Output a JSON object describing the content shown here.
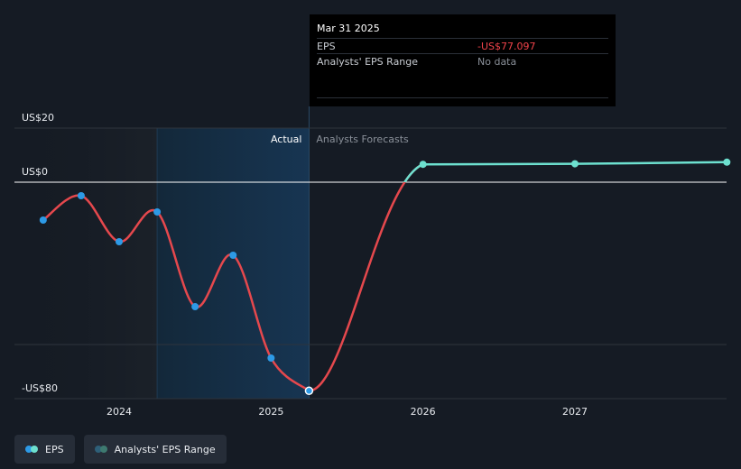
{
  "chart_data": {
    "type": "line",
    "y_ticks": [
      {
        "label": "US$20",
        "value": 20
      },
      {
        "label": "US$0",
        "value": 0
      },
      {
        "label": "-US$80",
        "value": -80
      }
    ],
    "ylim": [
      -80,
      20
    ],
    "x_ticks": [
      {
        "label": "2024",
        "value": 2024.0
      },
      {
        "label": "2025",
        "value": 2025.0
      },
      {
        "label": "2026",
        "value": 2026.0
      },
      {
        "label": "2027",
        "value": 2027.0
      }
    ],
    "xlim": [
      2023.3,
      2028.0
    ],
    "actual_start": 2024.25,
    "forecast_start": 2025.25,
    "region_labels": {
      "actual": "Actual",
      "forecast": "Analysts Forecasts"
    },
    "actual_series": {
      "name": "EPS",
      "x": [
        2023.5,
        2023.75,
        2024.0,
        2024.25,
        2024.5,
        2024.75,
        2025.0,
        2025.25
      ],
      "y": [
        -14,
        -5,
        -22,
        -11,
        -46,
        -27,
        -65,
        -77.1
      ]
    },
    "forecast_series": {
      "name": "EPS",
      "x": [
        2026.0,
        2027.0,
        2028.0
      ],
      "y": [
        6.6,
        6.8,
        7.4
      ]
    },
    "colors": {
      "actual": "#e5484d",
      "forecast": "#6de0cf",
      "point": "#2d9ae6",
      "background": "#151b24"
    },
    "gridlines": true,
    "legend": [
      {
        "label": "EPS",
        "colors": [
          "#2d9ae6",
          "#6de0cf"
        ]
      },
      {
        "label": "Analysts' EPS Range",
        "colors": [
          "#2e5f78",
          "#3e7a70"
        ]
      }
    ],
    "legend_position": "bottom-left"
  },
  "tooltip": {
    "date": "Mar 31 2025",
    "rows": [
      {
        "key": "EPS",
        "value": "-US$77.097"
      },
      {
        "key": "Analysts' EPS Range",
        "value": "No data"
      }
    ]
  }
}
